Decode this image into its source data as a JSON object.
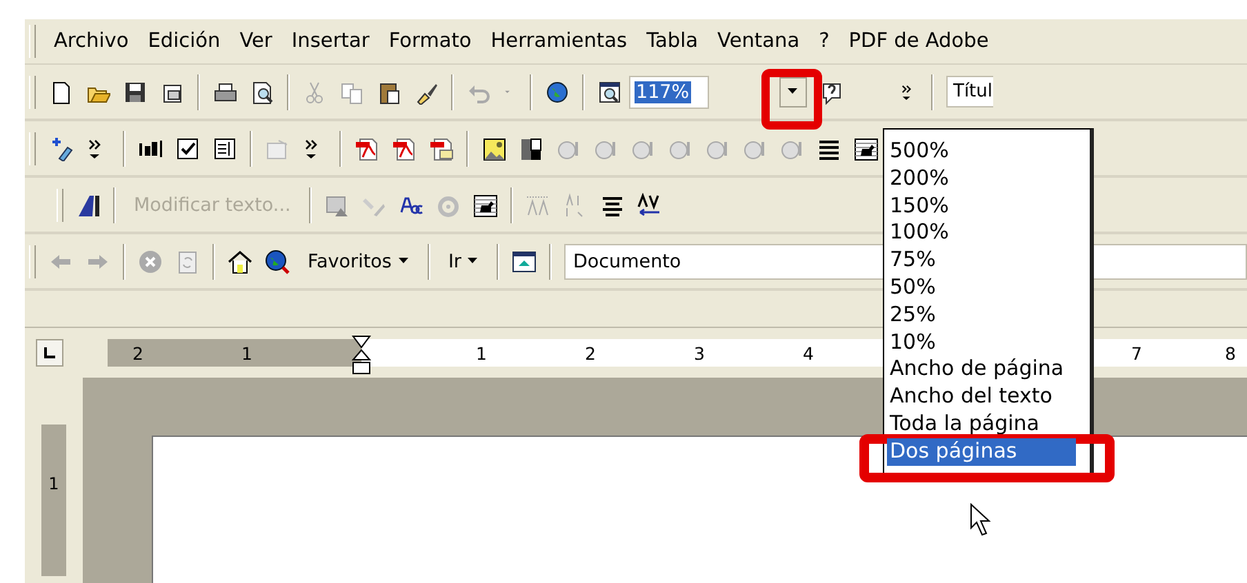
{
  "menu_bar": {
    "items": [
      {
        "label": "Archivo"
      },
      {
        "label": "Edición"
      },
      {
        "label": "Ver"
      },
      {
        "label": "Insertar"
      },
      {
        "label": "Formato"
      },
      {
        "label": "Herramientas"
      },
      {
        "label": "Tabla"
      },
      {
        "label": "Ventana"
      },
      {
        "label": "?"
      },
      {
        "label": "PDF de Adobe"
      }
    ]
  },
  "standard_toolbar": {
    "zoom_field": {
      "value": "117%"
    },
    "zoom_dropdown_button": {
      "highlighted": true
    },
    "style_field": {
      "value": "Títul"
    }
  },
  "wordart_toolbar": {
    "edit_text_button": {
      "label": "Modificar texto...",
      "disabled": true
    }
  },
  "web_toolbar": {
    "favorites_button": {
      "label": "Favoritos"
    },
    "go_button": {
      "label": "Ir"
    },
    "address_field": {
      "value": "Documento"
    }
  },
  "ruler": {
    "labels": [
      "2",
      "1",
      "1",
      "2",
      "3",
      "4",
      "7",
      "8"
    ]
  },
  "vertical_ruler": {
    "labels": [
      "1"
    ]
  },
  "zoom_menu": {
    "items": [
      {
        "label": "500%",
        "selected": false,
        "highlighted": false
      },
      {
        "label": "200%",
        "selected": false,
        "highlighted": false
      },
      {
        "label": "150%",
        "selected": false,
        "highlighted": false
      },
      {
        "label": "100%",
        "selected": false,
        "highlighted": false
      },
      {
        "label": "75%",
        "selected": false,
        "highlighted": false
      },
      {
        "label": "50%",
        "selected": false,
        "highlighted": false
      },
      {
        "label": "25%",
        "selected": false,
        "highlighted": false
      },
      {
        "label": "10%",
        "selected": false,
        "highlighted": false
      },
      {
        "label": "Ancho de página",
        "selected": false,
        "highlighted": false
      },
      {
        "label": "Ancho del texto",
        "selected": false,
        "highlighted": false
      },
      {
        "label": "Toda la página",
        "selected": false,
        "highlighted": false
      },
      {
        "label": "Dos páginas",
        "selected": true,
        "highlighted": true
      }
    ]
  }
}
